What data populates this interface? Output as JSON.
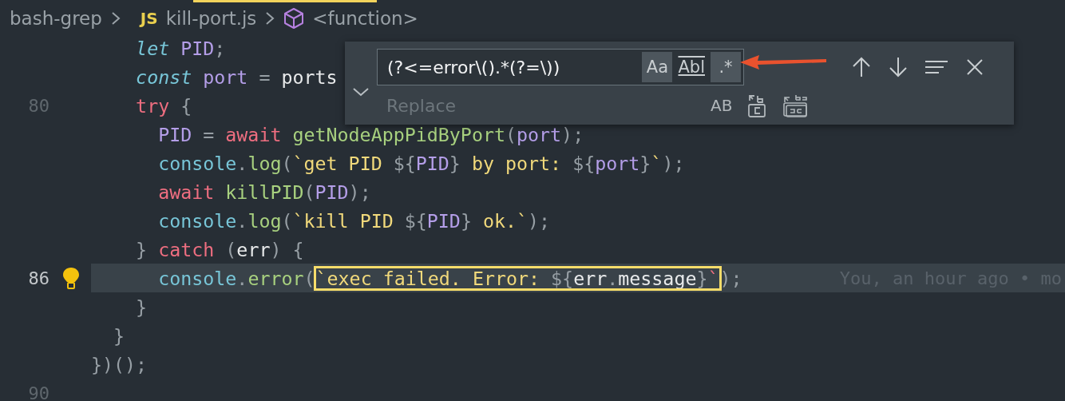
{
  "tab_indicator": {
    "selected": true
  },
  "breadcrumb": {
    "folder": "bash-grep",
    "file_badge": "JS",
    "file": "kill-port.js",
    "symbol": "<function>"
  },
  "lines": [
    {
      "tokens": [
        {
          "t": "    let ",
          "kind": "kw-italic"
        },
        {
          "t": "PID",
          "kind": "var"
        },
        {
          "t": ";",
          "kind": "punct"
        }
      ]
    },
    {
      "tokens": [
        {
          "t": "    const ",
          "kind": "kw-italic"
        },
        {
          "t": "port",
          "kind": "var"
        },
        {
          "t": " = ",
          "kind": "punct"
        },
        {
          "t": "ports",
          "kind": "text"
        }
      ]
    },
    {
      "number": "80",
      "tokens": [
        {
          "t": "    try",
          "kind": "kw"
        },
        {
          "t": " {",
          "kind": "punct"
        }
      ]
    },
    {
      "tokens": [
        {
          "t": "      PID",
          "kind": "var"
        },
        {
          "t": " = ",
          "kind": "punct"
        },
        {
          "t": "await ",
          "kind": "kw"
        },
        {
          "t": "getNodeAppPidByPort",
          "kind": "fn"
        },
        {
          "t": "(",
          "kind": "punct"
        },
        {
          "t": "port",
          "kind": "var"
        },
        {
          "t": ");",
          "kind": "punct"
        }
      ]
    },
    {
      "tokens": [
        {
          "t": "      console",
          "kind": "obj"
        },
        {
          "t": ".",
          "kind": "punct"
        },
        {
          "t": "log",
          "kind": "fn"
        },
        {
          "t": "(",
          "kind": "punct"
        },
        {
          "t": "`get PID ",
          "kind": "str"
        },
        {
          "t": "${",
          "kind": "punct"
        },
        {
          "t": "PID",
          "kind": "var"
        },
        {
          "t": "}",
          "kind": "punct"
        },
        {
          "t": " by port: ",
          "kind": "str"
        },
        {
          "t": "${",
          "kind": "punct"
        },
        {
          "t": "port",
          "kind": "var"
        },
        {
          "t": "}",
          "kind": "punct"
        },
        {
          "t": "`",
          "kind": "str"
        },
        {
          "t": ");",
          "kind": "punct"
        }
      ]
    },
    {
      "tokens": [
        {
          "t": "      await ",
          "kind": "kw"
        },
        {
          "t": "killPID",
          "kind": "fn"
        },
        {
          "t": "(",
          "kind": "punct"
        },
        {
          "t": "PID",
          "kind": "var"
        },
        {
          "t": ");",
          "kind": "punct"
        }
      ]
    },
    {
      "tokens": [
        {
          "t": "      console",
          "kind": "obj"
        },
        {
          "t": ".",
          "kind": "punct"
        },
        {
          "t": "log",
          "kind": "fn"
        },
        {
          "t": "(",
          "kind": "punct"
        },
        {
          "t": "`kill PID ",
          "kind": "str"
        },
        {
          "t": "${",
          "kind": "punct"
        },
        {
          "t": "PID",
          "kind": "var"
        },
        {
          "t": "}",
          "kind": "punct"
        },
        {
          "t": " ok.`",
          "kind": "str"
        },
        {
          "t": ");",
          "kind": "punct"
        }
      ]
    },
    {
      "tokens": [
        {
          "t": "    } ",
          "kind": "punct"
        },
        {
          "t": "catch",
          "kind": "kw"
        },
        {
          "t": " (",
          "kind": "punct"
        },
        {
          "t": "err",
          "kind": "text"
        },
        {
          "t": ") {",
          "kind": "punct"
        }
      ]
    },
    {
      "number": "86",
      "current": true,
      "lightbulb": true,
      "blame": "You, an hour ago • mo",
      "segments": [
        {
          "match": false,
          "tokens": [
            {
              "t": "      console",
              "kind": "obj"
            },
            {
              "t": ".",
              "kind": "punct"
            },
            {
              "t": "error",
              "kind": "fn"
            },
            {
              "t": "(",
              "kind": "punct"
            }
          ]
        },
        {
          "match": true,
          "tokens": [
            {
              "t": "`exec failed. Error: ",
              "kind": "str"
            },
            {
              "t": "${",
              "kind": "punct"
            },
            {
              "t": "err",
              "kind": "text"
            },
            {
              "t": ".",
              "kind": "punct"
            },
            {
              "t": "message",
              "kind": "text"
            },
            {
              "t": "}",
              "kind": "punct"
            },
            {
              "t": "`",
              "kind": "kw"
            }
          ]
        },
        {
          "match": false,
          "tokens": [
            {
              "t": ");",
              "kind": "punct"
            }
          ]
        }
      ]
    },
    {
      "tokens": [
        {
          "t": "    }",
          "kind": "punct"
        }
      ]
    },
    {
      "tokens": [
        {
          "t": "  }",
          "kind": "punct"
        }
      ]
    },
    {
      "tokens": [
        {
          "t": "})();",
          "kind": "punct"
        }
      ]
    },
    {
      "number": "90"
    }
  ],
  "find_widget": {
    "expanded": true,
    "find_value": "(?<=error\\().*(?=\\))",
    "toggles": [
      {
        "label": "Aa",
        "selected": true
      },
      {
        "label": "Abl",
        "selected": false
      },
      {
        "label": ".*",
        "selected": true
      }
    ],
    "replace_placeholder": "Replace",
    "preserve_case": "AB"
  }
}
